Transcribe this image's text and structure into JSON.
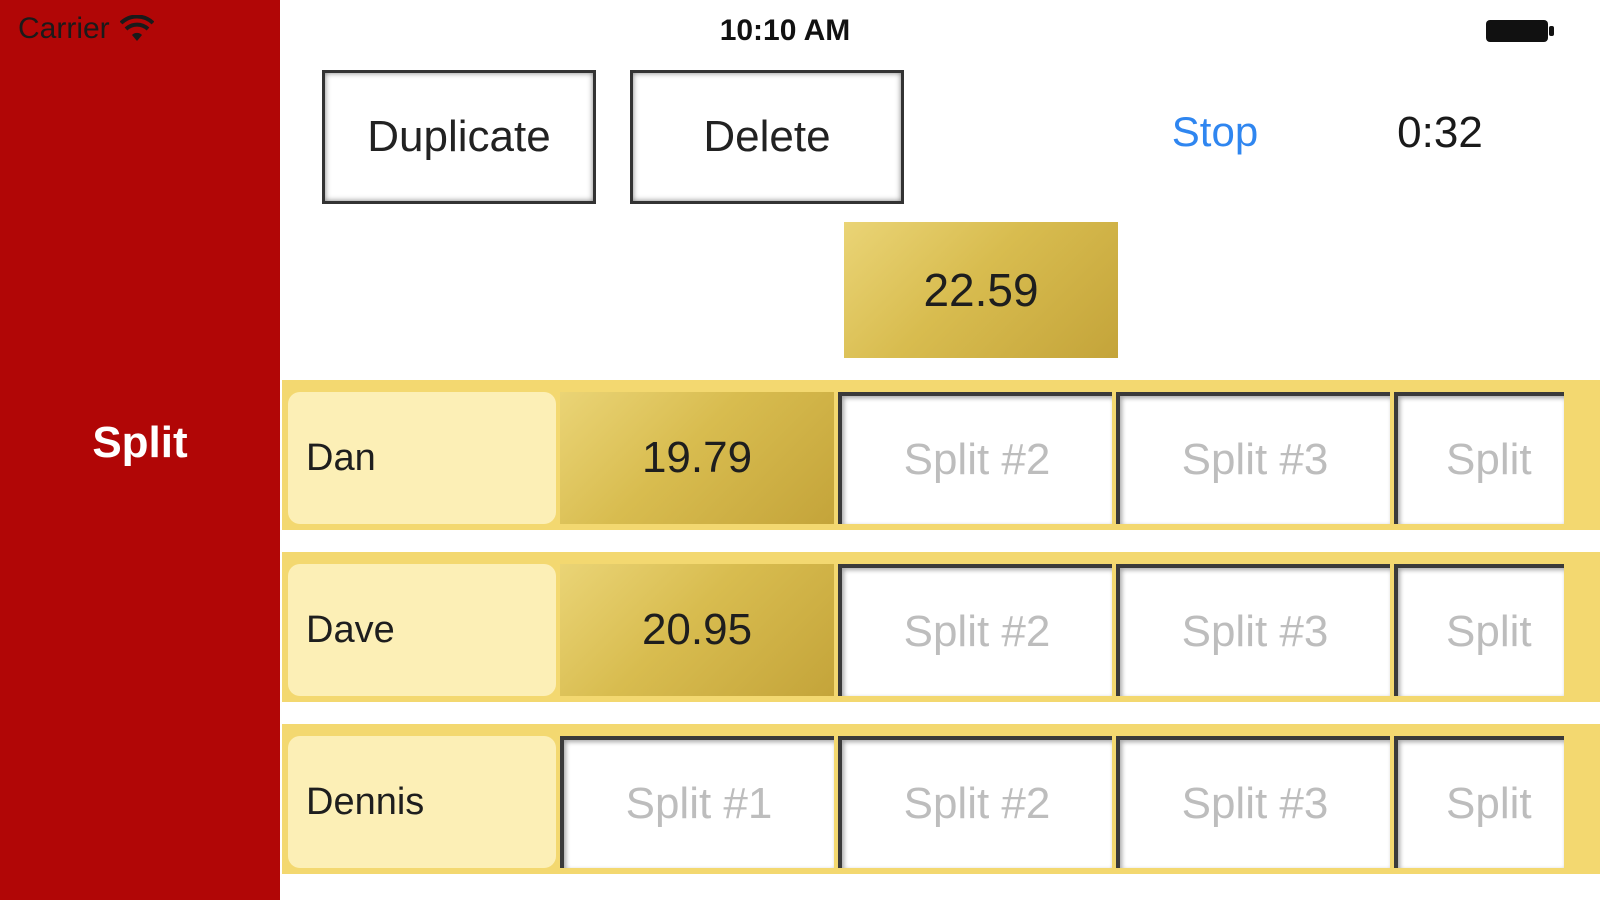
{
  "status_bar": {
    "carrier": "Carrier",
    "time": "10:10 AM",
    "wifi_icon": "wifi-icon",
    "battery_icon": "battery-icon"
  },
  "sidebar": {
    "label": "Split",
    "color": "#b10606"
  },
  "toolbar": {
    "duplicate_label": "Duplicate",
    "delete_label": "Delete",
    "stop_label": "Stop",
    "timer": "0:32",
    "stop_color": "#2f86f0"
  },
  "target": {
    "value": "22.59"
  },
  "rows": [
    {
      "name": "Dan",
      "splits": [
        "19.79",
        "Split #2",
        "Split #3",
        "Split"
      ]
    },
    {
      "name": "Dave",
      "splits": [
        "20.95",
        "Split #2",
        "Split #3",
        "Split"
      ]
    },
    {
      "name": "Dennis",
      "splits": [
        "Split #1",
        "Split #2",
        "Split #3",
        "Split"
      ]
    }
  ],
  "colors": {
    "gold": "#d8bc4f",
    "row_background": "#f3d870",
    "name_background": "#fcefb6",
    "placeholder_text": "#bdbdbd"
  }
}
